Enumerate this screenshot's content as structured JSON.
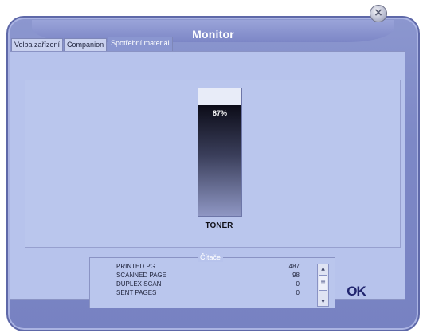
{
  "window": {
    "title": "Monitor"
  },
  "tabs": [
    {
      "label": "Volba zařízení",
      "active": false
    },
    {
      "label": "Companion",
      "active": false
    },
    {
      "label": "Spotřební materiál",
      "active": true
    }
  ],
  "toner": {
    "label": "TONER",
    "percent_text": "87%",
    "level": 0.87
  },
  "counters": {
    "title": "Čítače",
    "rows": [
      {
        "label": "PRINTED PG",
        "value": "487"
      },
      {
        "label": "SCANNED PAGE",
        "value": "98"
      },
      {
        "label": "DUPLEX SCAN",
        "value": "0"
      },
      {
        "label": "SENT PAGES",
        "value": "0"
      }
    ]
  },
  "buttons": {
    "ok_label": "OK",
    "close_glyph": "×"
  },
  "icons": {
    "close": "close-icon",
    "scroll_up": "chevron-up-icon",
    "scroll_down": "chevron-down-icon"
  },
  "colors": {
    "window": "#7d88c6",
    "panel": "#b7c3ec",
    "active_tab": "#8a96d0",
    "ok_text": "#20246e"
  }
}
